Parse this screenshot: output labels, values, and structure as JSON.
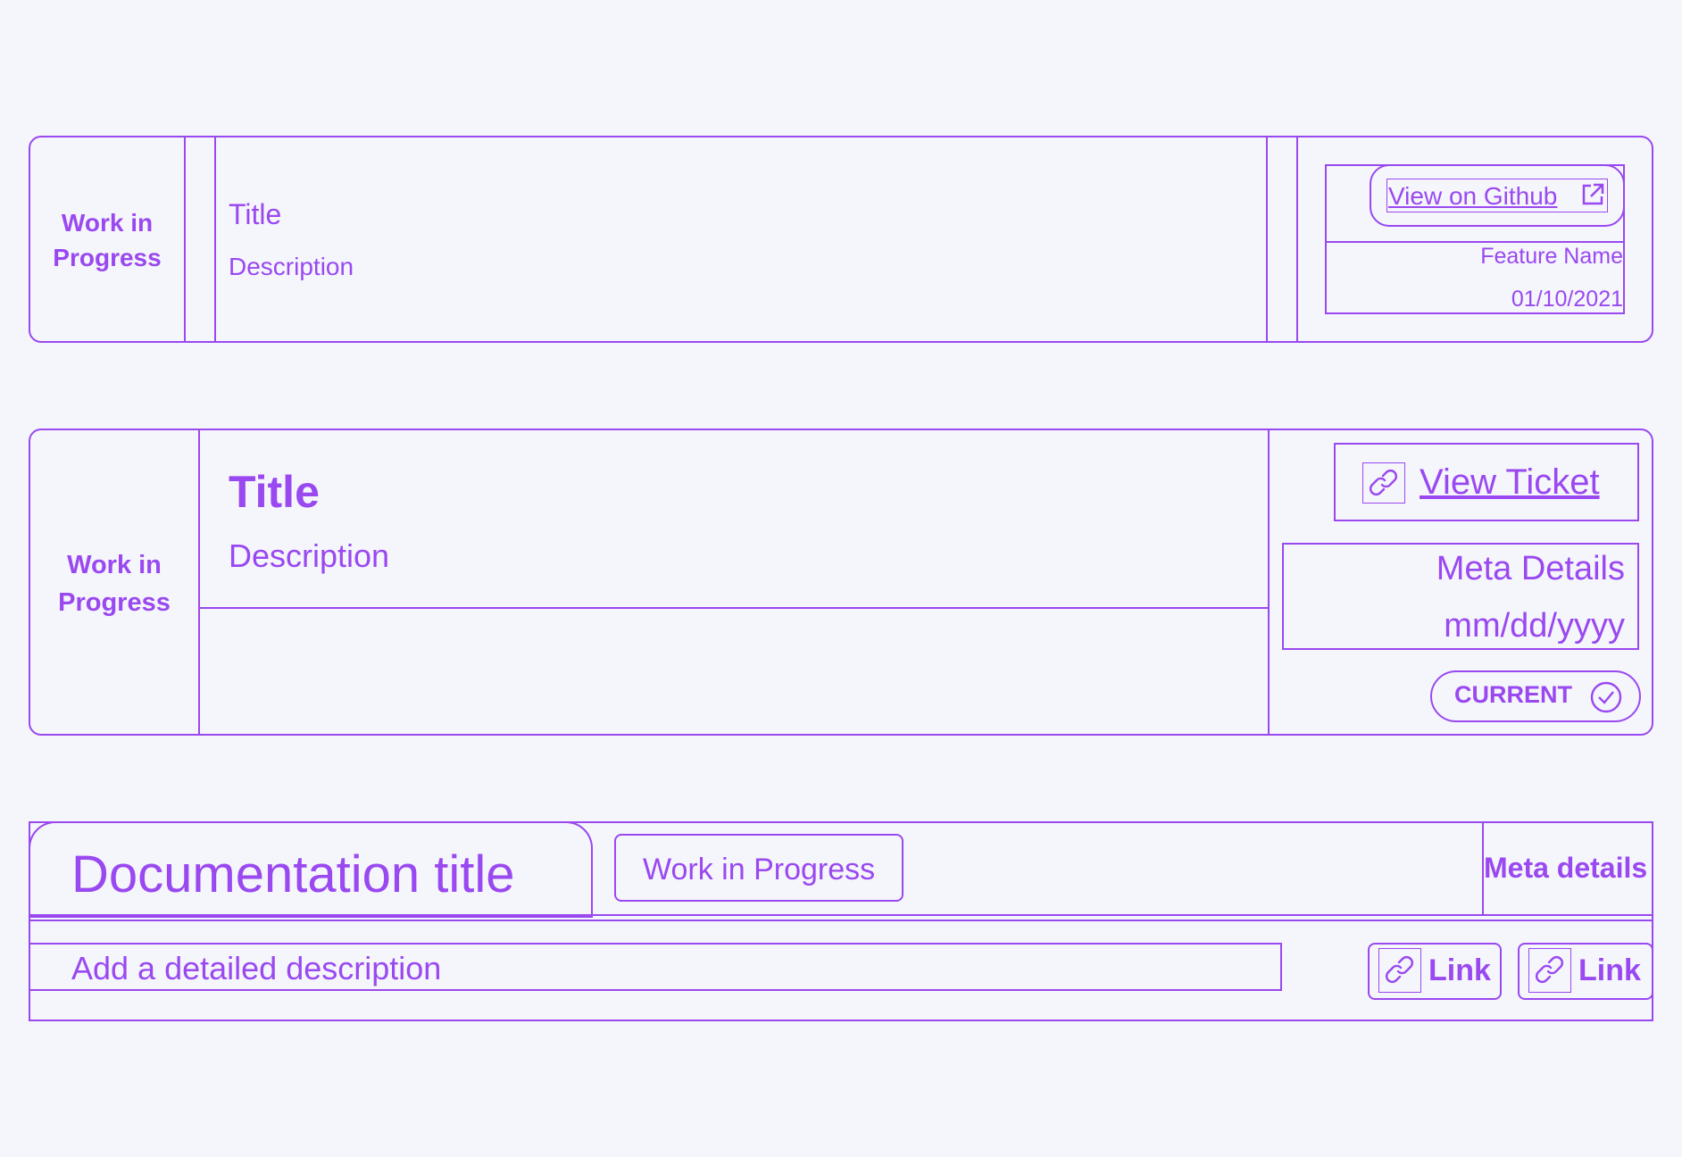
{
  "colors": {
    "accent": "#9a48f0",
    "background": "#f4f6fc"
  },
  "card1": {
    "status": "Work in Progress",
    "title": "Title",
    "description": "Description",
    "link_label": "View on Github",
    "link_icon": "external-link-icon",
    "feature_name": "Feature Name",
    "date": "01/10/2021"
  },
  "card2": {
    "status": "Work in Progress",
    "title": "Title",
    "description": "Description",
    "link_label": "View Ticket",
    "link_icon": "link-icon",
    "meta_details": "Meta Details",
    "date_placeholder": "mm/dd/yyyy",
    "badge_label": "CURRENT",
    "badge_icon": "check-circle-icon"
  },
  "card3": {
    "title": "Documentation title",
    "status": "Work in Progress",
    "meta_details": "Meta details",
    "description_placeholder": "Add a detailed description",
    "links": [
      {
        "label": "Link",
        "icon": "link-icon"
      },
      {
        "label": "Link",
        "icon": "link-icon"
      }
    ]
  }
}
